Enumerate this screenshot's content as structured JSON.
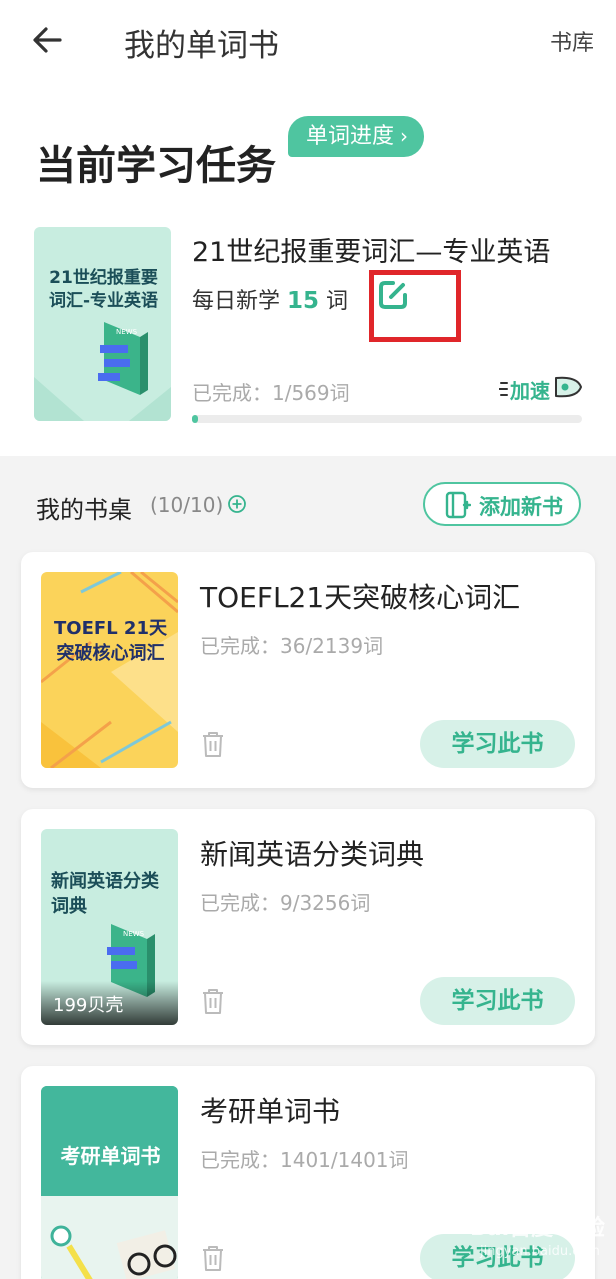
{
  "header": {
    "title": "我的单词书",
    "right_link": "书库"
  },
  "current_task": {
    "section_title": "当前学习任务",
    "progress_pill": "单词进度",
    "cover_text": "21世纪报重要词汇-专业英语",
    "book_title": "21世纪报重要词汇—专业英语",
    "daily_prefix": "每日新学",
    "daily_count": "15",
    "daily_unit": "词",
    "completed_text": "已完成：1/569词",
    "progress_fraction": 0.0018,
    "speed_label": "加速"
  },
  "desk": {
    "title": "我的书桌",
    "count": "(10/10)",
    "add_button_label": "添加新书"
  },
  "books": [
    {
      "title": "TOEFL21天突破核心词汇",
      "cover_text": "TOEFL 21天突破核心词汇",
      "completed_text": "已完成：36/2139词",
      "study_label": "学习此书"
    },
    {
      "title": "新闻英语分类词典",
      "cover_text": "新闻英语分类词典",
      "cover_price": "199贝壳",
      "completed_text": "已完成：9/3256词",
      "study_label": "学习此书"
    },
    {
      "title": "考研单词书",
      "cover_text": "考研单词书",
      "completed_text": "已完成：1401/1401词",
      "study_label": "学习此书"
    }
  ],
  "colors": {
    "accent": "#4fc5a0",
    "accent_text": "#35b48e",
    "highlight": "#e0262a"
  },
  "watermark": {
    "text": "Bai百度 经验",
    "sub": "jingyan.baidu.com"
  }
}
